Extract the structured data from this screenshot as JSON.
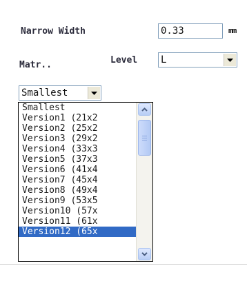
{
  "narrow_width": {
    "label": "Narrow Width",
    "value": "0.33",
    "unit": "mm"
  },
  "level": {
    "label": "Level",
    "selected": "L"
  },
  "matrix": {
    "label": "Matr..",
    "selected": "Smallest"
  },
  "dropdown": {
    "items": [
      "Smallest",
      "Version1 (21x2",
      "Version2 (25x2",
      "Version3 (29x2",
      "Version4 (33x3",
      "Version5 (37x3",
      "Version6 (41x4",
      "Version7 (45x4",
      "Version8 (49x4",
      "Version9 (53x5",
      "Version10 (57x",
      "Version11 (61x",
      "Version12 (65x"
    ],
    "highlighted_index": 12
  },
  "icons": {
    "combo_arrow": "chevron-down-icon",
    "scroll_up": "scroll-up-icon",
    "scroll_down": "scroll-down-icon"
  },
  "colors": {
    "selection": "#316ac5",
    "field_border": "#7f9db9",
    "scrollbar_button": "#c3d5fb"
  }
}
